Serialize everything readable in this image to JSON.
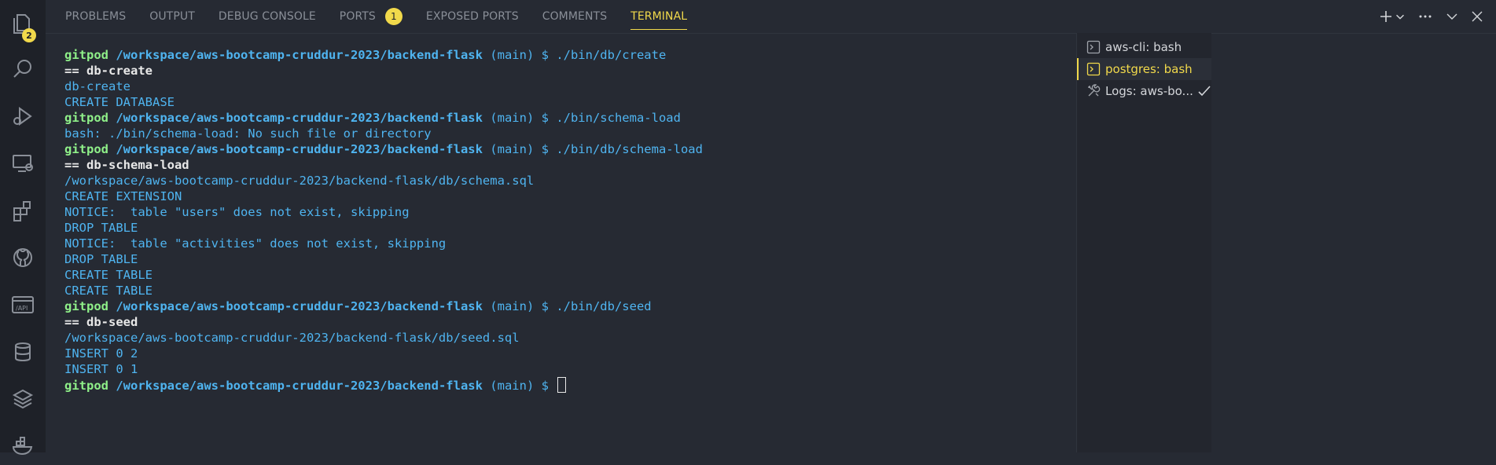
{
  "activity_bar": {
    "explorer_badge": "2",
    "icons": [
      "files-icon",
      "search-icon",
      "run-debug-icon",
      "remote-explorer-icon",
      "extensions-icon",
      "github-icon",
      "api-icon",
      "database-icon",
      "layers-icon",
      "docker-icon"
    ]
  },
  "panel": {
    "tabs": [
      {
        "label": "PROBLEMS"
      },
      {
        "label": "OUTPUT"
      },
      {
        "label": "DEBUG CONSOLE"
      },
      {
        "label": "PORTS",
        "badge": "1"
      },
      {
        "label": "EXPOSED PORTS"
      },
      {
        "label": "COMMENTS"
      },
      {
        "label": "TERMINAL",
        "active": true
      }
    ],
    "actions": [
      "add-terminal-icon",
      "terminal-dropdown-icon",
      "more-actions-icon",
      "collapse-panel-icon",
      "close-panel-icon"
    ]
  },
  "terminal": {
    "prompt": {
      "user": "gitpod",
      "path": "/workspace/aws-bootcamp-cruddur-2023/backend-flask",
      "branch": "(main)",
      "symbol": "$"
    },
    "lines": [
      {
        "type": "prompt",
        "cmd": "./bin/db/create"
      },
      {
        "type": "bold",
        "text": "== db-create"
      },
      {
        "type": "text",
        "text": "db-create"
      },
      {
        "type": "text",
        "text": "CREATE DATABASE"
      },
      {
        "type": "prompt",
        "cmd": "./bin/schema-load"
      },
      {
        "type": "text",
        "text": "bash: ./bin/schema-load: No such file or directory"
      },
      {
        "type": "prompt",
        "cmd": "./bin/db/schema-load"
      },
      {
        "type": "bold",
        "text": "== db-schema-load"
      },
      {
        "type": "text",
        "text": "/workspace/aws-bootcamp-cruddur-2023/backend-flask/db/schema.sql"
      },
      {
        "type": "text",
        "text": "CREATE EXTENSION"
      },
      {
        "type": "text",
        "text": "NOTICE:  table \"users\" does not exist, skipping"
      },
      {
        "type": "text",
        "text": "DROP TABLE"
      },
      {
        "type": "text",
        "text": "NOTICE:  table \"activities\" does not exist, skipping"
      },
      {
        "type": "text",
        "text": "DROP TABLE"
      },
      {
        "type": "text",
        "text": "CREATE TABLE"
      },
      {
        "type": "text",
        "text": "CREATE TABLE"
      },
      {
        "type": "prompt",
        "cmd": "./bin/db/seed"
      },
      {
        "type": "bold",
        "text": "== db-seed"
      },
      {
        "type": "text",
        "text": "/workspace/aws-bootcamp-cruddur-2023/backend-flask/db/seed.sql"
      },
      {
        "type": "text",
        "text": "INSERT 0 2"
      },
      {
        "type": "text",
        "text": "INSERT 0 1"
      },
      {
        "type": "prompt",
        "cmd": "",
        "cursor": true
      }
    ]
  },
  "terminal_list": {
    "items": [
      {
        "label": "aws-cli: bash",
        "icon": "terminal-icon"
      },
      {
        "label": "postgres: bash",
        "icon": "terminal-icon",
        "active": true
      },
      {
        "label": "Logs: aws-bo...",
        "icon": "tools-icon",
        "done": true
      }
    ]
  },
  "colors": {
    "accent": "#f1d94b",
    "prompt_user": "#8ff089",
    "terminal_text": "#4fb4f0",
    "background": "#262a33"
  }
}
